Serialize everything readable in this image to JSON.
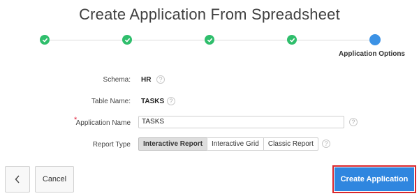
{
  "header": {
    "title": "Create Application From Spreadsheet"
  },
  "wizard": {
    "steps": [
      {
        "state": "complete",
        "icon": "check-icon"
      },
      {
        "state": "complete",
        "icon": "check-icon"
      },
      {
        "state": "complete",
        "icon": "check-icon"
      },
      {
        "state": "complete",
        "icon": "check-icon"
      },
      {
        "state": "current",
        "label": "Application Options"
      }
    ]
  },
  "form": {
    "schema": {
      "label": "Schema:",
      "value": "HR"
    },
    "table_name": {
      "label": "Table Name:",
      "value": "TASKS"
    },
    "application_name": {
      "label": "Application Name",
      "value": "TASKS",
      "required_marker": "*"
    },
    "report_type": {
      "label": "Report Type",
      "options": [
        "Interactive Report",
        "Interactive Grid",
        "Classic Report"
      ],
      "selected": "Interactive Report"
    },
    "help_glyph": "?"
  },
  "buttons": {
    "back_icon": "chevron-left-icon",
    "cancel": "Cancel",
    "create": "Create Application"
  },
  "colors": {
    "complete_step": "#2fbe6c",
    "current_step": "#3c92e5",
    "primary_button": "#2f86df",
    "highlight_border": "#d9262c",
    "required": "#e0203a"
  }
}
